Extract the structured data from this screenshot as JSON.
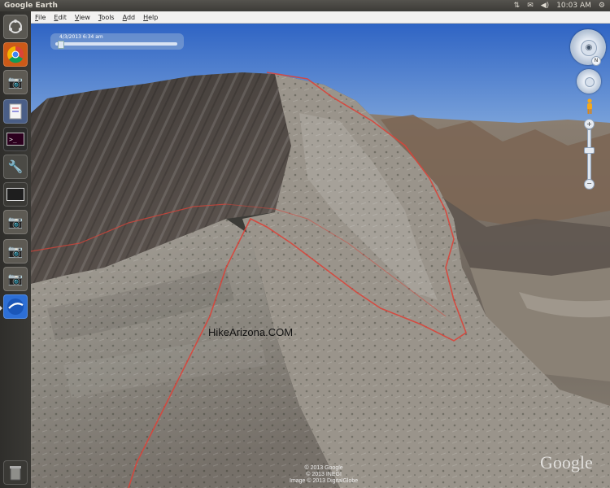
{
  "window": {
    "title": "Google Earth"
  },
  "top_panel": {
    "clock": "10:03 AM",
    "tray_icons": [
      "network-arrows-icon",
      "mail-envelope-icon",
      "volume-speaker-icon",
      "clock-text",
      "gear-icon"
    ]
  },
  "menu": [
    "File",
    "Edit",
    "View",
    "Tools",
    "Add",
    "Help"
  ],
  "launcher": {
    "items": [
      {
        "name": "dash-home",
        "icon": "ubuntu-logo-icon"
      },
      {
        "name": "chrome",
        "icon": "chrome-icon"
      },
      {
        "name": "camera-app",
        "icon": "camera-icon"
      },
      {
        "name": "text-editor",
        "icon": "document-icon"
      },
      {
        "name": "terminal",
        "icon": "terminal-icon"
      },
      {
        "name": "tools",
        "icon": "wrench-icon"
      },
      {
        "name": "workspace",
        "icon": "window-icon"
      },
      {
        "name": "camera-app-2",
        "icon": "camera-icon"
      },
      {
        "name": "camera-app-3",
        "icon": "camera-icon"
      },
      {
        "name": "camera-app-4",
        "icon": "camera-icon"
      },
      {
        "name": "google-earth",
        "icon": "google-earth-icon"
      },
      {
        "name": "trash",
        "icon": "trash-icon"
      }
    ]
  },
  "time_slider": {
    "label": "4/3/2013 6:34 am",
    "position": 0.02
  },
  "navigation": {
    "north_label": "N",
    "zoom_in": "+",
    "zoom_out": "−",
    "zoom_level": 0.4
  },
  "map": {
    "watermark": "HikeArizona.COM",
    "copyright_line1": "© 2013 Google",
    "copyright_line2": "© 2013 INEGI",
    "copyright_line3": "Image © 2013 DigitalGlobe",
    "logo": "Google"
  },
  "colors": {
    "track": "#d9443a",
    "sky": "#3d72c6",
    "panel": "#3c3b37",
    "launcher_selected": "#cc5a18"
  }
}
